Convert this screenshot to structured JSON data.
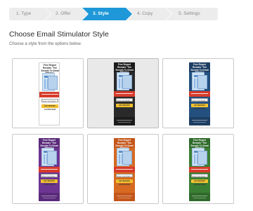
{
  "wizard": {
    "steps": [
      {
        "label": "1. Type",
        "active": false
      },
      {
        "label": "2. Offer",
        "active": false
      },
      {
        "label": "3. Style",
        "active": true
      },
      {
        "label": "4. Copy",
        "active": false
      },
      {
        "label": "5. Settings",
        "active": false
      }
    ]
  },
  "page": {
    "title": "Choose Email Stimulator Style",
    "subtitle": "Choose a style from the options below."
  },
  "widget_text": {
    "headline": "Free Report Reveals \"The Secrets To Great Fitness\"",
    "input_placeholder": "Enter Your Email Here",
    "button_label": "GET INSTANT ACCESS NOW"
  },
  "styles": [
    {
      "name": "white",
      "selected": false,
      "head_color": "#ffffff",
      "body_color": "#ffffff",
      "text_color": "#222222"
    },
    {
      "name": "dark",
      "selected": true,
      "head_color": "#1c1c1c",
      "body_color": "#2a2a2a",
      "text_color": "#ffffff"
    },
    {
      "name": "blue",
      "selected": false,
      "head_color": "#1d3e63",
      "body_color": "#24507f",
      "text_color": "#ffffff"
    },
    {
      "name": "purple",
      "selected": false,
      "head_color": "#5a2a7a",
      "body_color": "#6d3592",
      "text_color": "#ffffff"
    },
    {
      "name": "orange",
      "selected": false,
      "head_color": "#c4561b",
      "body_color": "#d66a22",
      "text_color": "#ffffff"
    },
    {
      "name": "green",
      "selected": false,
      "head_color": "#2f6a2b",
      "body_color": "#3b7f34",
      "text_color": "#ffffff"
    }
  ]
}
